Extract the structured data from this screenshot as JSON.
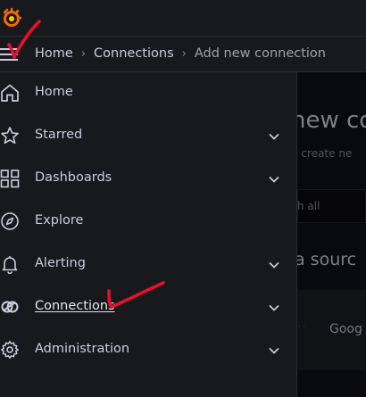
{
  "breadcrumb": {
    "home": "Home",
    "connections": "Connections",
    "current": "Add new connection"
  },
  "background": {
    "title": "new co",
    "subtitle": "d create ne",
    "search": "h all",
    "heading": "a sourc",
    "card_label": "Goog"
  },
  "nav": {
    "items": [
      {
        "label": "Home",
        "icon": "home-icon",
        "expandable": false
      },
      {
        "label": "Starred",
        "icon": "star-icon",
        "expandable": true
      },
      {
        "label": "Dashboards",
        "icon": "dashboards-grid-icon",
        "expandable": true
      },
      {
        "label": "Explore",
        "icon": "compass-icon",
        "expandable": false
      },
      {
        "label": "Alerting",
        "icon": "bell-icon",
        "expandable": true
      },
      {
        "label": "Connections",
        "icon": "link-icon",
        "expandable": true,
        "active": true
      },
      {
        "label": "Administration",
        "icon": "gear-icon",
        "expandable": true
      }
    ]
  },
  "colors": {
    "panel": "#18191d",
    "background": "#111217",
    "text": "#ccccdc",
    "logo_orange": "#f46800",
    "annotation_red": "#e8112d"
  }
}
